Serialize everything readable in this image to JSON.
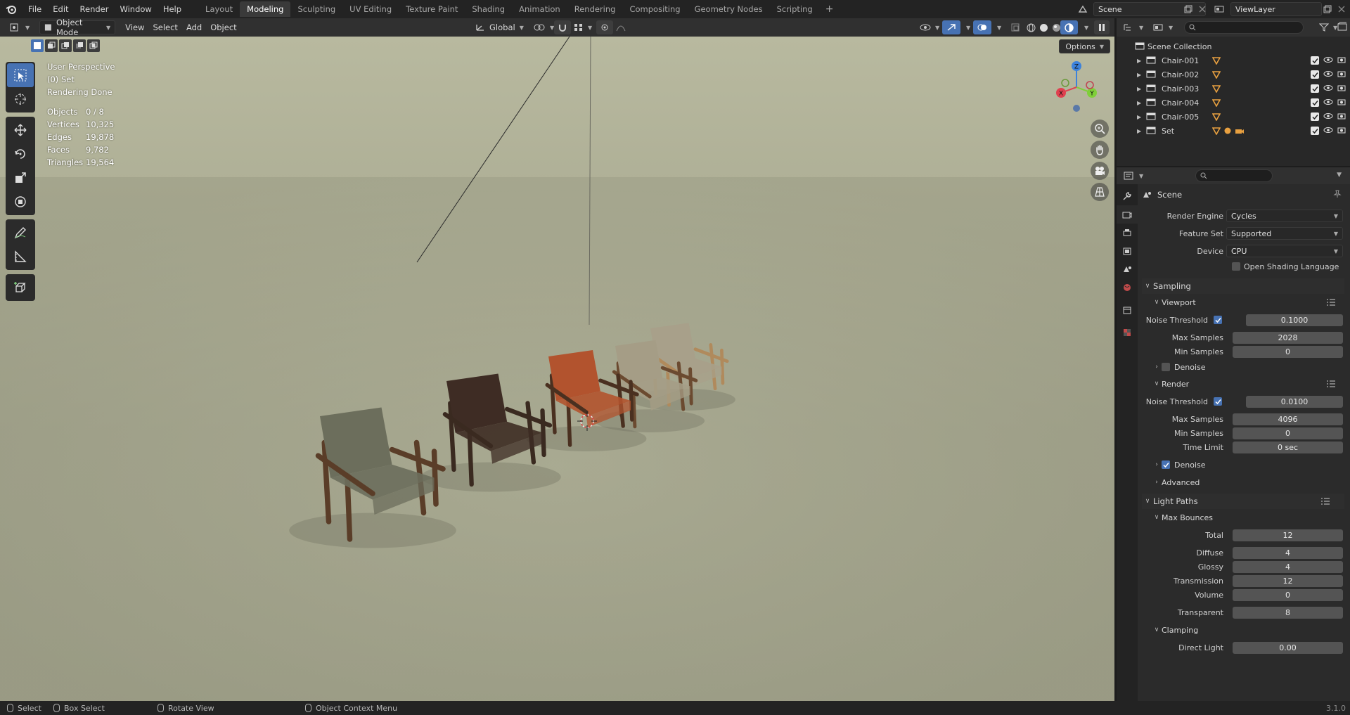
{
  "topbar": {
    "menus": [
      "File",
      "Edit",
      "Render",
      "Window",
      "Help"
    ],
    "workspaces": [
      "Layout",
      "Modeling",
      "Sculpting",
      "UV Editing",
      "Texture Paint",
      "Shading",
      "Animation",
      "Rendering",
      "Compositing",
      "Geometry Nodes",
      "Scripting"
    ],
    "active_workspace": "Modeling",
    "add_tab": "+",
    "scene": "Scene",
    "view_layer": "ViewLayer"
  },
  "viewport_header": {
    "mode": "Object Mode",
    "menus": [
      "View",
      "Select",
      "Add",
      "Object"
    ],
    "orientation": "Global",
    "options": "Options"
  },
  "viewport": {
    "perspective": "User Perspective",
    "collection": "(0) Set",
    "status": "Rendering Done",
    "stats": [
      {
        "k": "Objects",
        "v": "0 / 8"
      },
      {
        "k": "Vertices",
        "v": "10,325"
      },
      {
        "k": "Edges",
        "v": "19,878"
      },
      {
        "k": "Faces",
        "v": "9,782"
      },
      {
        "k": "Triangles",
        "v": "19,564"
      }
    ],
    "gizmo": {
      "x": "X",
      "y": "Y",
      "z": "Z"
    },
    "chairs": [
      {
        "color": "#6c6e5c",
        "frame": "#5a3d28"
      },
      {
        "color": "#3e2c24",
        "frame": "#3a2a20"
      },
      {
        "color": "#b2532e",
        "frame": "#4a3020"
      },
      {
        "color": "#a59d86",
        "frame": "#6b4a30"
      },
      {
        "color": "#a8a08a",
        "frame": "#b08a5c"
      }
    ]
  },
  "outliner": {
    "root": "Scene Collection",
    "items": [
      "Chair-001",
      "Chair-002",
      "Chair-003",
      "Chair-004",
      "Chair-005",
      "Set"
    ]
  },
  "properties": {
    "context": "Scene",
    "render_engine_label": "Render Engine",
    "render_engine": "Cycles",
    "feature_set_label": "Feature Set",
    "feature_set": "Supported",
    "device_label": "Device",
    "device": "CPU",
    "osl": "Open Shading Language",
    "sampling": "Sampling",
    "viewport": {
      "title": "Viewport",
      "noise_threshold_label": "Noise Threshold",
      "noise_threshold": "0.1000",
      "max_samples_label": "Max Samples",
      "max_samples": "2028",
      "min_samples_label": "Min Samples",
      "min_samples": "0",
      "denoise": "Denoise"
    },
    "render": {
      "title": "Render",
      "noise_threshold_label": "Noise Threshold",
      "noise_threshold": "0.0100",
      "max_samples_label": "Max Samples",
      "max_samples": "4096",
      "min_samples_label": "Min Samples",
      "min_samples": "0",
      "time_limit_label": "Time Limit",
      "time_limit": "0 sec",
      "denoise": "Denoise",
      "advanced": "Advanced"
    },
    "light_paths": "Light Paths",
    "max_bounces": {
      "title": "Max Bounces",
      "total_label": "Total",
      "total": "12",
      "diffuse_label": "Diffuse",
      "diffuse": "4",
      "glossy_label": "Glossy",
      "glossy": "4",
      "transmission_label": "Transmission",
      "transmission": "12",
      "volume_label": "Volume",
      "volume": "0",
      "transparent_label": "Transparent",
      "transparent": "8"
    },
    "clamping": {
      "title": "Clamping",
      "direct_light_label": "Direct Light",
      "direct_light": "0.00"
    }
  },
  "statusbar": {
    "select": "Select",
    "box_select": "Box Select",
    "rotate_view": "Rotate View",
    "context_menu": "Object Context Menu",
    "version": "3.1.0"
  },
  "colors": {
    "accent": "#4772b3",
    "gizmo_x": "#e0404f",
    "gizmo_y": "#7fcf3a",
    "gizmo_z": "#3c82dc"
  }
}
